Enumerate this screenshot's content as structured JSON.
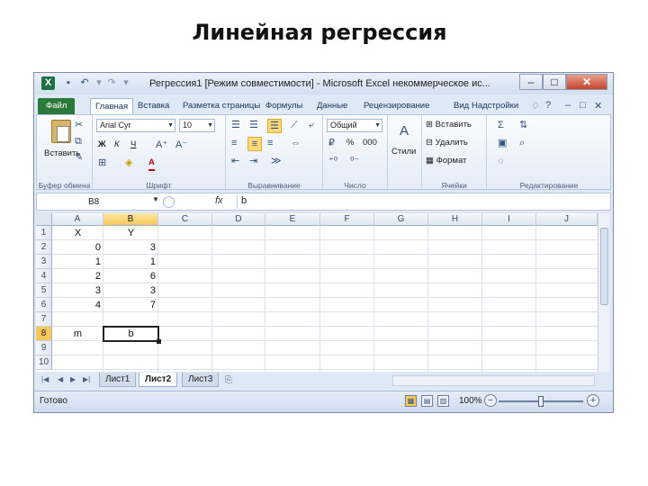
{
  "slide": {
    "title": "Линейная регрессия"
  },
  "window": {
    "title": "Регрессия1 [Режим совместимости] - Microsoft Excel некоммерческое ис...",
    "app_icon": "X"
  },
  "ribbon_tabs": [
    "Файл",
    "Главная",
    "Вставка",
    "Разметка страницы",
    "Формулы",
    "Данные",
    "Рецензирование",
    "Вид",
    "Надстройки"
  ],
  "ribbon": {
    "clipboard": {
      "paste_label": "Вставить",
      "group_label": "Буфер обмена"
    },
    "font": {
      "font_name": "Arial Cyr",
      "font_size": "10",
      "bold": "Ж",
      "italic": "К",
      "underline": "Ч",
      "font_color_glyph": "А",
      "group_label": "Шрифт"
    },
    "alignment": {
      "group_label": "Выравнивание"
    },
    "number": {
      "format": "Общий",
      "percent": "%",
      "thousands": "000",
      "group_label": "Число"
    },
    "styles": {
      "label": "Стили"
    },
    "cells": {
      "insert": "Вставить",
      "delete": "Удалить",
      "format": "Формат",
      "group_label": "Ячейки"
    },
    "editing": {
      "group_label": "Редактирование"
    }
  },
  "formula_bar": {
    "name_box": "B8",
    "fx": "fx",
    "value": "b"
  },
  "columns": [
    "A",
    "B",
    "C",
    "D",
    "E",
    "F",
    "G",
    "H",
    "I",
    "J"
  ],
  "rows": [
    "1",
    "2",
    "3",
    "4",
    "5",
    "6",
    "7",
    "8",
    "9",
    "10"
  ],
  "cells": {
    "A1": "X",
    "B1": "Y",
    "A2": "0",
    "B2": "3",
    "A3": "1",
    "B3": "1",
    "A4": "2",
    "B4": "6",
    "A5": "3",
    "B5": "3",
    "A6": "4",
    "B6": "7",
    "A8": "m",
    "B8": "b"
  },
  "sheets": [
    "Лист1",
    "Лист2",
    "Лист3"
  ],
  "active_sheet": "Лист2",
  "status": {
    "ready": "Готово",
    "zoom": "100%"
  },
  "colors": {
    "file_tab": "#2b7a3b",
    "selection": "#f7c85a",
    "excel_green": "#1e7145"
  }
}
